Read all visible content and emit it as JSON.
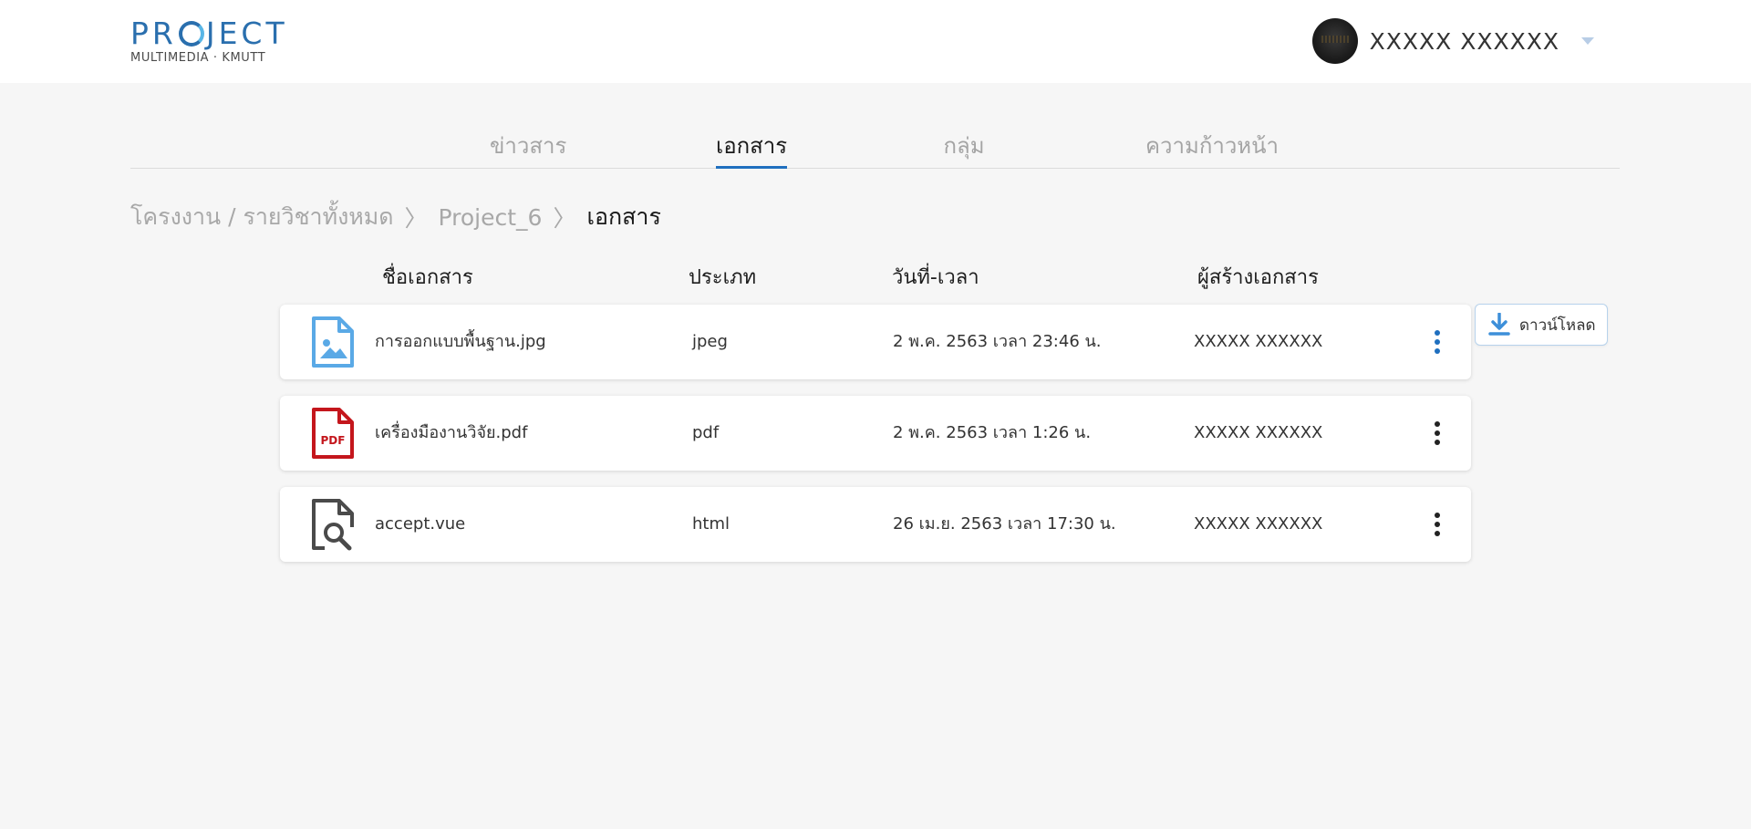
{
  "header": {
    "logo_title_pre": "PR",
    "logo_title_post": "JECT",
    "logo_subtitle": "MULTIMEDIA · KMUTT",
    "user_name": "XXXXX XXXXXX"
  },
  "tabs": [
    {
      "label": "ข่าวสาร",
      "active": false
    },
    {
      "label": "เอกสาร",
      "active": true
    },
    {
      "label": "กลุ่ม",
      "active": false
    },
    {
      "label": "ความก้าวหน้า",
      "active": false
    }
  ],
  "breadcrumb": {
    "root": "โครงงาน / รายวิชาทั้งหมด",
    "sep": "〉",
    "project": "Project_6",
    "current": "เอกสาร"
  },
  "table": {
    "headers": {
      "name": "ชื่อเอกสาร",
      "type": "ประเภท",
      "date": "วันที่-เวลา",
      "owner": "ผู้สร้างเอกสาร"
    },
    "rows": [
      {
        "icon": "image-file-icon",
        "name": "การออกแบบพื้นฐาน.jpg",
        "type": "jpeg",
        "date": "2 พ.ค. 2563 เวลา 23:46 น.",
        "owner": "XXXXX XXXXXX"
      },
      {
        "icon": "pdf-file-icon",
        "pdf_label": "PDF",
        "name": "เครื่องมืองานวิจัย.pdf",
        "type": "pdf",
        "date": "2 พ.ค. 2563 เวลา 1:26 น.",
        "owner": "XXXXX XXXXXX"
      },
      {
        "icon": "file-search-icon",
        "name": "accept.vue",
        "type": "html",
        "date": "26 เม.ย. 2563 เวลา 17:30 น.",
        "owner": "XXXXX XXXXXX"
      }
    ]
  },
  "download": {
    "label": "ดาวน์โหลด",
    "icon": "download-icon"
  },
  "colors": {
    "accent": "#1f6fbf",
    "image_icon": "#5aa9e6",
    "pdf_icon": "#c4161c",
    "search_icon": "#4a4a4a",
    "kebab_active": "#1f6fbf",
    "kebab": "#222222"
  }
}
